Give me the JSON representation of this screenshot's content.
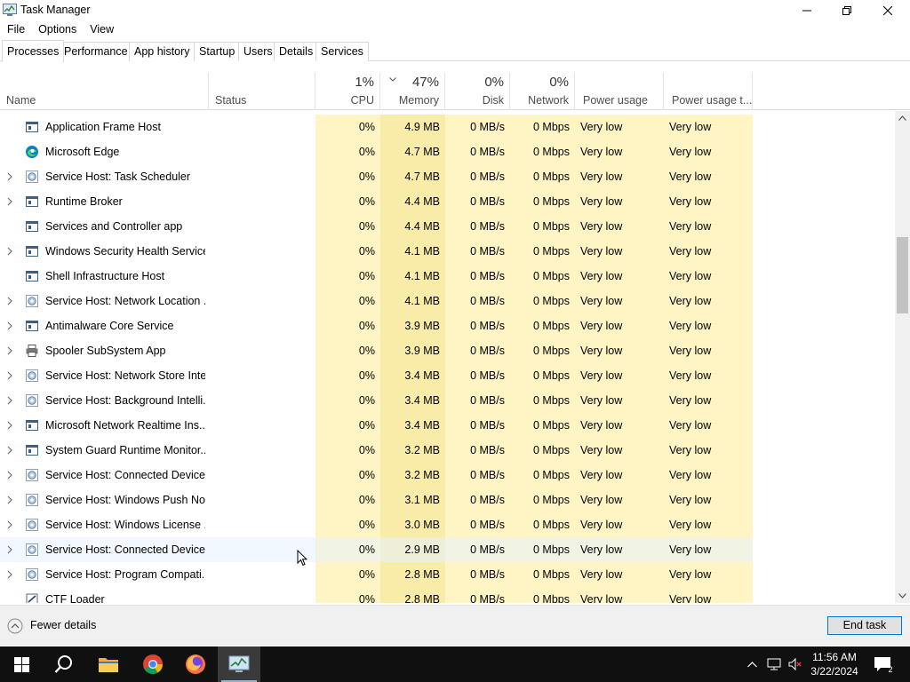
{
  "window": {
    "title": "Task Manager"
  },
  "menu": [
    "File",
    "Options",
    "View"
  ],
  "tabs": [
    "Processes",
    "Performance",
    "App history",
    "Startup",
    "Users",
    "Details",
    "Services"
  ],
  "columns": {
    "name": "Name",
    "status": "Status",
    "cpu": {
      "pct": "1%",
      "label": "CPU"
    },
    "memory": {
      "pct": "47%",
      "label": "Memory"
    },
    "disk": {
      "pct": "0%",
      "label": "Disk"
    },
    "network": {
      "pct": "0%",
      "label": "Network"
    },
    "power": "Power usage",
    "power_trend": "Power usage t..."
  },
  "rows": [
    {
      "name": "Application Frame Host",
      "icon": "app-window-icon",
      "expand": false,
      "cpu": "0%",
      "memory": "4.9 MB",
      "disk": "0 MB/s",
      "network": "0 Mbps",
      "power": "Very low",
      "trend": "Very low"
    },
    {
      "name": "Microsoft Edge",
      "icon": "edge-icon",
      "expand": false,
      "cpu": "0%",
      "memory": "4.7 MB",
      "disk": "0 MB/s",
      "network": "0 Mbps",
      "power": "Very low",
      "trend": "Very low"
    },
    {
      "name": "Service Host: Task Scheduler",
      "icon": "gear-icon",
      "expand": true,
      "cpu": "0%",
      "memory": "4.7 MB",
      "disk": "0 MB/s",
      "network": "0 Mbps",
      "power": "Very low",
      "trend": "Very low"
    },
    {
      "name": "Runtime Broker",
      "icon": "app-window-icon",
      "expand": true,
      "cpu": "0%",
      "memory": "4.4 MB",
      "disk": "0 MB/s",
      "network": "0 Mbps",
      "power": "Very low",
      "trend": "Very low"
    },
    {
      "name": "Services and Controller app",
      "icon": "app-window-icon",
      "expand": false,
      "cpu": "0%",
      "memory": "4.4 MB",
      "disk": "0 MB/s",
      "network": "0 Mbps",
      "power": "Very low",
      "trend": "Very low"
    },
    {
      "name": "Windows Security Health Service",
      "icon": "app-window-icon",
      "expand": true,
      "cpu": "0%",
      "memory": "4.1 MB",
      "disk": "0 MB/s",
      "network": "0 Mbps",
      "power": "Very low",
      "trend": "Very low"
    },
    {
      "name": "Shell Infrastructure Host",
      "icon": "app-window-icon",
      "expand": false,
      "cpu": "0%",
      "memory": "4.1 MB",
      "disk": "0 MB/s",
      "network": "0 Mbps",
      "power": "Very low",
      "trend": "Very low"
    },
    {
      "name": "Service Host: Network Location ...",
      "icon": "gear-icon",
      "expand": true,
      "cpu": "0%",
      "memory": "4.1 MB",
      "disk": "0 MB/s",
      "network": "0 Mbps",
      "power": "Very low",
      "trend": "Very low"
    },
    {
      "name": "Antimalware Core Service",
      "icon": "app-window-icon",
      "expand": true,
      "cpu": "0%",
      "memory": "3.9 MB",
      "disk": "0 MB/s",
      "network": "0 Mbps",
      "power": "Very low",
      "trend": "Very low"
    },
    {
      "name": "Spooler SubSystem App",
      "icon": "printer-icon",
      "expand": true,
      "cpu": "0%",
      "memory": "3.9 MB",
      "disk": "0 MB/s",
      "network": "0 Mbps",
      "power": "Very low",
      "trend": "Very low"
    },
    {
      "name": "Service Host: Network Store Inte...",
      "icon": "gear-icon",
      "expand": true,
      "cpu": "0%",
      "memory": "3.4 MB",
      "disk": "0 MB/s",
      "network": "0 Mbps",
      "power": "Very low",
      "trend": "Very low"
    },
    {
      "name": "Service Host: Background Intelli...",
      "icon": "gear-icon",
      "expand": true,
      "cpu": "0%",
      "memory": "3.4 MB",
      "disk": "0 MB/s",
      "network": "0 Mbps",
      "power": "Very low",
      "trend": "Very low"
    },
    {
      "name": "Microsoft Network Realtime Ins...",
      "icon": "app-window-icon",
      "expand": true,
      "cpu": "0%",
      "memory": "3.4 MB",
      "disk": "0 MB/s",
      "network": "0 Mbps",
      "power": "Very low",
      "trend": "Very low"
    },
    {
      "name": "System Guard Runtime Monitor...",
      "icon": "app-window-icon",
      "expand": true,
      "cpu": "0%",
      "memory": "3.2 MB",
      "disk": "0 MB/s",
      "network": "0 Mbps",
      "power": "Very low",
      "trend": "Very low"
    },
    {
      "name": "Service Host: Connected Device...",
      "icon": "gear-icon",
      "expand": true,
      "cpu": "0%",
      "memory": "3.2 MB",
      "disk": "0 MB/s",
      "network": "0 Mbps",
      "power": "Very low",
      "trend": "Very low"
    },
    {
      "name": "Service Host: Windows Push No...",
      "icon": "gear-icon",
      "expand": true,
      "cpu": "0%",
      "memory": "3.1 MB",
      "disk": "0 MB/s",
      "network": "0 Mbps",
      "power": "Very low",
      "trend": "Very low"
    },
    {
      "name": "Service Host: Windows License ...",
      "icon": "gear-icon",
      "expand": true,
      "cpu": "0%",
      "memory": "3.0 MB",
      "disk": "0 MB/s",
      "network": "0 Mbps",
      "power": "Very low",
      "trend": "Very low"
    },
    {
      "name": "Service Host: Connected Device...",
      "icon": "gear-icon",
      "expand": true,
      "cpu": "0%",
      "memory": "2.9 MB",
      "disk": "0 MB/s",
      "network": "0 Mbps",
      "power": "Very low",
      "trend": "Very low",
      "hover": true
    },
    {
      "name": "Service Host: Program Compati...",
      "icon": "gear-icon",
      "expand": true,
      "cpu": "0%",
      "memory": "2.8 MB",
      "disk": "0 MB/s",
      "network": "0 Mbps",
      "power": "Very low",
      "trend": "Very low"
    },
    {
      "name": "CTF Loader",
      "icon": "ctf-loader-icon",
      "expand": false,
      "cpu": "0%",
      "memory": "2.8 MB",
      "disk": "0 MB/s",
      "network": "0 Mbps",
      "power": "Very low",
      "trend": "Very low"
    }
  ],
  "footer": {
    "fewer_details": "Fewer details",
    "end_task": "End task"
  },
  "taskbar": {
    "time": "11:56 AM",
    "date": "3/22/2024",
    "notifications": "2"
  },
  "colors": {
    "heat_light": "#fff4c4",
    "heat_memory": "#f9eca8",
    "accent": "#0078d7"
  }
}
